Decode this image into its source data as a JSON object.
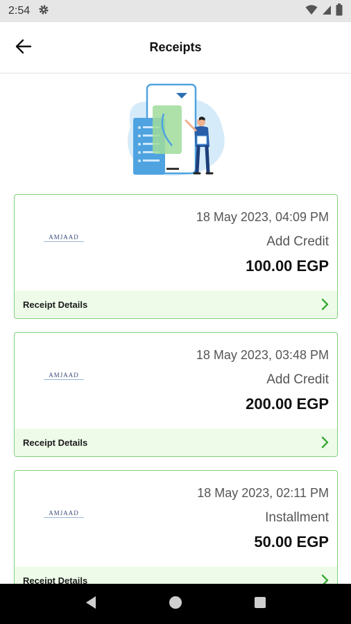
{
  "status_bar": {
    "time": "2:54"
  },
  "app_bar": {
    "title": "Receipts"
  },
  "receipts": [
    {
      "logo_text": "AMJAAD",
      "date": "18 May 2023, 04:09 PM",
      "type": "Add Credit",
      "amount": "100.00 EGP",
      "details_label": "Receipt Details"
    },
    {
      "logo_text": "AMJAAD",
      "date": "18 May 2023, 03:48 PM",
      "type": "Add Credit",
      "amount": "200.00 EGP",
      "details_label": "Receipt Details"
    },
    {
      "logo_text": "AMJAAD",
      "date": "18 May 2023, 02:11 PM",
      "type": "Installment",
      "amount": "50.00 EGP",
      "details_label": "Receipt Details"
    }
  ],
  "colors": {
    "card_border": "#7fd17a",
    "card_footer": "#eefbe9",
    "chevron": "#3aa935",
    "illustration_blue": "#4fa3e0"
  },
  "icons": {
    "back": "arrow-left-icon",
    "gear": "gear-icon",
    "wifi": "wifi-icon",
    "signal": "signal-icon",
    "battery": "battery-icon",
    "chevron": "chevron-right-icon"
  }
}
